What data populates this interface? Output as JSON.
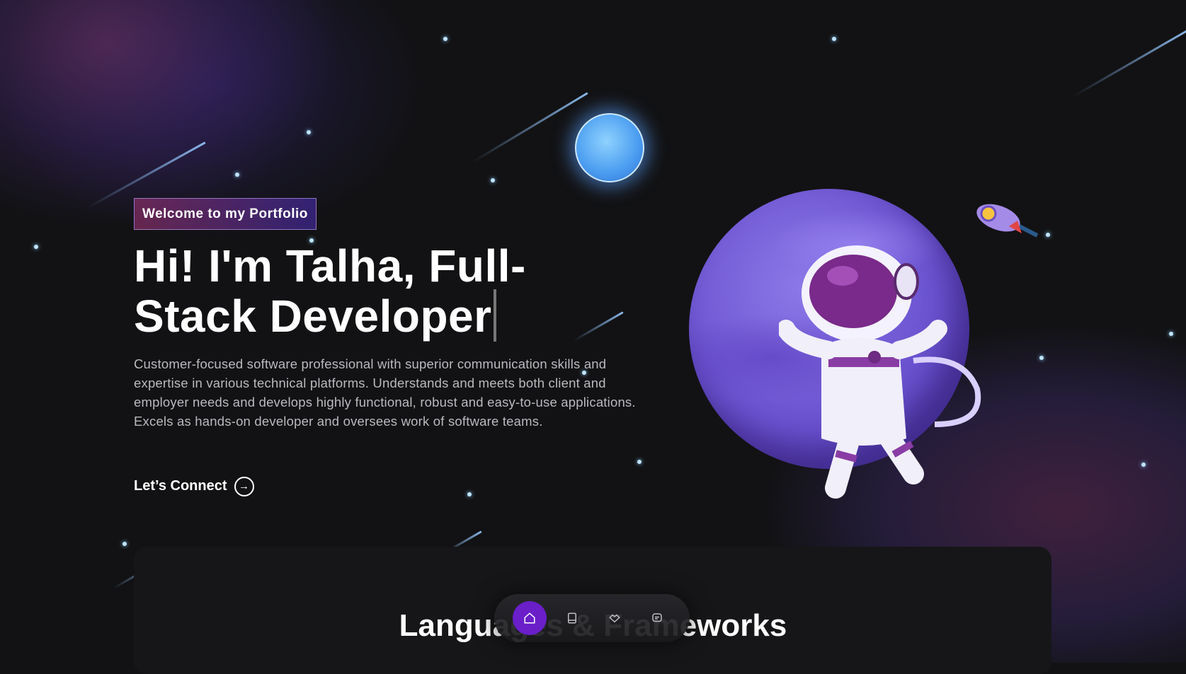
{
  "hero": {
    "badge": "Welcome to my Portfolio",
    "headline": "Hi! I'm Talha, Full-Stack Developer",
    "description": "Customer-focused software professional with superior communication skills and expertise in various technical platforms. Understands and meets both client and employer needs and develops highly functional, robust and easy-to-use applications. Excels as hands-on developer and oversees work of software teams.",
    "cta_label": "Let’s Connect",
    "cta_icon": "arrow-right-circle-icon"
  },
  "next_section": {
    "title": "Languages & Frameworks"
  },
  "dock": {
    "items": [
      {
        "name": "home",
        "icon": "home-icon",
        "active": true
      },
      {
        "name": "projects",
        "icon": "book-icon",
        "active": false
      },
      {
        "name": "skills",
        "icon": "handshake-icon",
        "active": false
      },
      {
        "name": "contact",
        "icon": "chat-icon",
        "active": false
      }
    ]
  },
  "colors": {
    "background": "#121214",
    "accent": "#6a1fc9",
    "badge_gradient_start": "#aa367c",
    "badge_gradient_end": "#4a2fbd"
  }
}
